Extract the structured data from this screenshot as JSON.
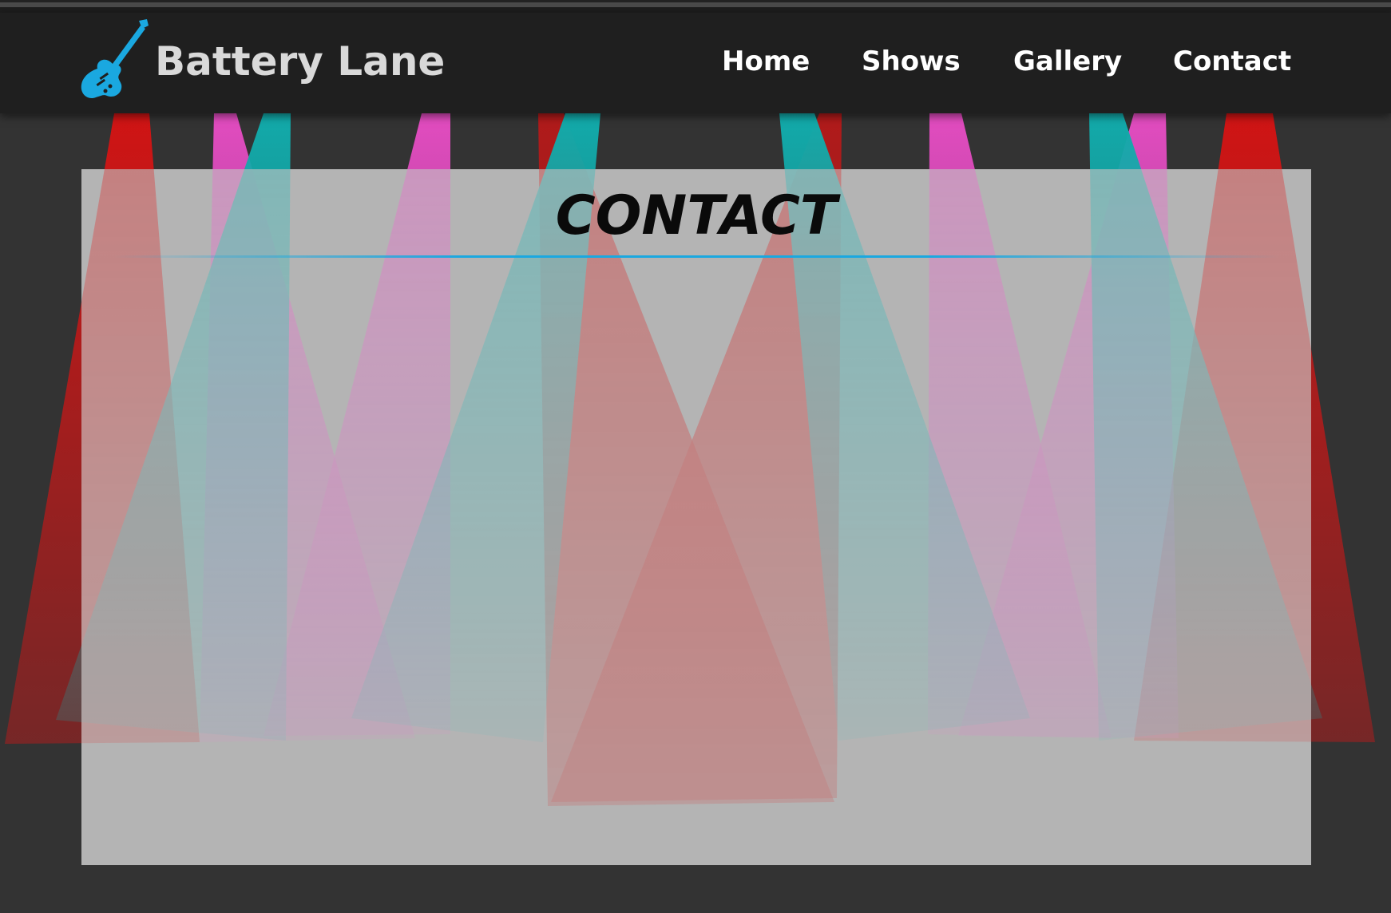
{
  "site": {
    "brand_name": "Battery Lane",
    "logo_icon": "electric-guitar-icon",
    "accent_color": "#1aa8e0"
  },
  "nav": {
    "items": [
      {
        "label": "Home"
      },
      {
        "label": "Shows"
      },
      {
        "label": "Gallery"
      },
      {
        "label": "Contact"
      }
    ]
  },
  "page": {
    "title": "CONTACT"
  },
  "background": {
    "theme": "stage spotlights",
    "beam_colors": [
      "#c81818",
      "#e040b0",
      "#10a8a8"
    ]
  }
}
